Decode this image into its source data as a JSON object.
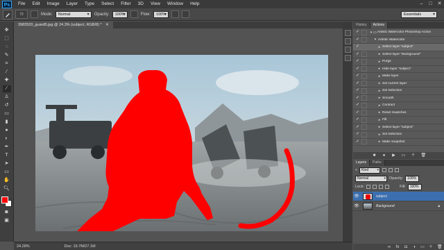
{
  "menu": {
    "app_logo": "Ps",
    "items": [
      "File",
      "Edit",
      "Image",
      "Layer",
      "Type",
      "Select",
      "Filter",
      "3D",
      "View",
      "Window",
      "Help"
    ]
  },
  "options": {
    "brush_size": "72",
    "mode_label": "Mode:",
    "mode_value": "Normal",
    "opacity_label": "Opacity:",
    "opacity_value": "100%",
    "flow_label": "Flow:",
    "flow_value": "100%",
    "workspace": "Essentials"
  },
  "document": {
    "tab_title": "3983520_guard5.jpg @ 24.3% (subject, RGB/8) *"
  },
  "status": {
    "zoom": "24.28%",
    "doc_size": "Doc: 19.7M/27.1M"
  },
  "actions_panel": {
    "tabs": [
      "History",
      "Actions"
    ],
    "active_tab": "Actions",
    "rows": [
      {
        "label": "Artistic Watercolor Photoshop Action",
        "indent": 0,
        "expanded": true,
        "folder": true
      },
      {
        "label": "Artistic Watercolor",
        "indent": 1,
        "expanded": true,
        "folder": false
      },
      {
        "label": "Select layer \"subject\"",
        "indent": 2,
        "expanded": false,
        "selected": true
      },
      {
        "label": "Select layer \"Background\"",
        "indent": 2,
        "expanded": false
      },
      {
        "label": "Purge",
        "indent": 2,
        "expanded": false
      },
      {
        "label": "Hide layer \"subject\"",
        "indent": 2,
        "expanded": false
      },
      {
        "label": "Make layer",
        "indent": 2,
        "expanded": false
      },
      {
        "label": "Set current layer",
        "indent": 2,
        "expanded": false
      },
      {
        "label": "Set Selection",
        "indent": 2,
        "expanded": false
      },
      {
        "label": "Smooth",
        "indent": 2,
        "expanded": false
      },
      {
        "label": "Contract",
        "indent": 2,
        "expanded": false
      },
      {
        "label": "Reset Swatches",
        "indent": 2,
        "expanded": false
      },
      {
        "label": "Fill",
        "indent": 2,
        "expanded": false
      },
      {
        "label": "Select layer \"subject\"",
        "indent": 2,
        "expanded": false
      },
      {
        "label": "Set Selection",
        "indent": 2,
        "expanded": false
      },
      {
        "label": "Make snapshot",
        "indent": 2,
        "expanded": false
      }
    ]
  },
  "layers_panel": {
    "tabs": [
      "Layers",
      "Paths"
    ],
    "active_tab": "Layers",
    "kind_label": "Kind",
    "blend_mode": "Normal",
    "opacity_label": "Opacity:",
    "opacity_value": "100%",
    "lock_label": "Lock:",
    "fill_label": "Fill:",
    "fill_value": "100%",
    "layers": [
      {
        "name": "subject",
        "selected": true,
        "italic": false
      },
      {
        "name": "Background",
        "selected": false,
        "italic": true
      }
    ]
  },
  "colors": {
    "foreground": "#ff0000",
    "background": "#ffffff",
    "subject_mask": "#ff0000"
  }
}
